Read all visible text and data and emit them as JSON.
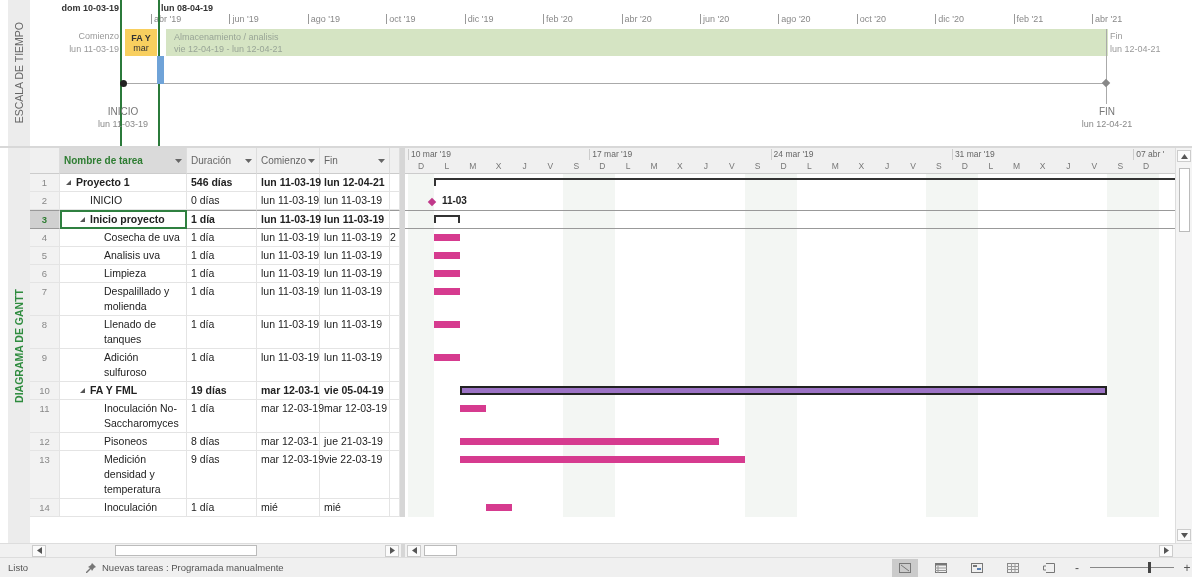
{
  "timeline": {
    "label": "ESCALA DE TIEMPO",
    "range_start": "dom 10-03-19",
    "range_end": "lun 08-04-19",
    "ticks": [
      "abr '19",
      "jun '19",
      "ago '19",
      "oct '19",
      "dic '19",
      "feb '20",
      "abr '20",
      "jun '20",
      "ago '20",
      "oct '20",
      "dic '20",
      "feb '21",
      "abr '21"
    ],
    "start": {
      "label": "Comienzo",
      "date": "lun 11-03-19"
    },
    "finish": {
      "label": "Fin",
      "date": "lun 12-04-21"
    },
    "bars": [
      {
        "kind": "callout",
        "name": "FA Y",
        "date": "mar",
        "color": "#f8cf5f"
      },
      {
        "kind": "span",
        "name": "Almacenamiento / analisis",
        "date": "vie 12-04-19 - lun 12-04-21",
        "color": "#d5e4c3"
      },
      {
        "kind": "marker",
        "color": "#6fa3d8"
      }
    ],
    "milestones": [
      {
        "kind": "start",
        "name": "INICIO",
        "date": "lun 11-03-19"
      },
      {
        "kind": "finish",
        "name": "FIN",
        "date": "lun 12-04-21"
      }
    ]
  },
  "view_label": "DIAGRAMA DE GANTT",
  "table": {
    "columns": [
      {
        "label": "Nombre de tarea",
        "selected": true
      },
      {
        "label": "Duración",
        "selected": false
      },
      {
        "label": "Comienzo",
        "selected": false
      },
      {
        "label": "Fin",
        "selected": false
      }
    ],
    "rows": [
      {
        "id": "1",
        "name": "Proyecto 1",
        "duration": "546 días",
        "start": "lun 11-03-19",
        "finish": "lun 12-04-21",
        "kind": "summary",
        "expanded": true,
        "selected": false,
        "children": [
          {
            "id": "2",
            "name": "INICIO",
            "duration": "0 días",
            "start": "lun 11-03-19",
            "finish": "lun 11-03-19",
            "kind": "milestone",
            "bar_label": "11-03",
            "selected": false
          },
          {
            "id": "3",
            "name": "Inicio proyecto",
            "duration": "1 día",
            "start": "lun 11-03-19",
            "finish": "lun 11-03-19",
            "kind": "summary",
            "expanded": true,
            "selected": true,
            "children": [
              {
                "id": "4",
                "name": "Cosecha de uva",
                "duration": "1 día",
                "start": "lun 11-03-19",
                "finish": "lun 11-03-19",
                "column_5": "2",
                "kind": "task",
                "selected": false
              },
              {
                "id": "5",
                "name": "Analisis uva",
                "duration": "1 día",
                "start": "lun 11-03-19",
                "finish": "lun 11-03-19",
                "kind": "task",
                "selected": false
              },
              {
                "id": "6",
                "name": "Limpieza",
                "duration": "1 día",
                "start": "lun 11-03-19",
                "finish": "lun 11-03-19",
                "kind": "task",
                "selected": false
              },
              {
                "id": "7",
                "name": "Despalillado y molienda",
                "duration": "1 día",
                "start": "lun 11-03-19",
                "finish": "lun 11-03-19",
                "kind": "task",
                "selected": false
              },
              {
                "id": "8",
                "name": "Llenado de tanques",
                "duration": "1 día",
                "start": "lun 11-03-19",
                "finish": "lun 11-03-19",
                "kind": "task",
                "selected": false
              },
              {
                "id": "9",
                "name": "Adición sulfuroso",
                "duration": "1 día",
                "start": "lun 11-03-19",
                "finish": "lun 11-03-19",
                "kind": "task",
                "selected": false
              }
            ]
          },
          {
            "id": "10",
            "name": "FA Y FML",
            "duration": "19 días",
            "start": "mar 12-03-1",
            "finish": "vie 05-04-19",
            "kind": "summary_filled",
            "expanded": true,
            "selected": false,
            "children": [
              {
                "id": "11",
                "name": "Inoculación No-Saccharomyces",
                "duration": "1 día",
                "start": "mar 12-03-19",
                "finish": "mar 12-03-19",
                "kind": "task",
                "selected": false
              },
              {
                "id": "12",
                "name": "Pisoneos",
                "duration": "8 días",
                "start": "mar 12-03-1",
                "finish": "jue 21-03-19",
                "kind": "task",
                "selected": false
              },
              {
                "id": "13",
                "name": "Medición densidad y temperatura",
                "duration": "9 días",
                "start": "mar 12-03-19",
                "finish": "vie 22-03-19",
                "kind": "task",
                "selected": false
              },
              {
                "id": "14",
                "name": "Inoculación",
                "duration": "1 día",
                "start": "mié",
                "finish": "mié",
                "kind": "task",
                "selected": false
              }
            ]
          }
        ]
      }
    ]
  },
  "gantt": {
    "weeks": [
      "10 mar '19",
      "17 mar '19",
      "24 mar '19",
      "31 mar '19",
      "07 abr '"
    ],
    "days": [
      "D",
      "L",
      "M",
      "X",
      "J",
      "V",
      "S",
      "D",
      "L",
      "M",
      "X",
      "J",
      "V",
      "S",
      "D",
      "L",
      "M",
      "X",
      "J",
      "V",
      "S",
      "D",
      "L",
      "M",
      "X",
      "J",
      "V",
      "S",
      "D"
    ]
  },
  "status_bar": {
    "text": "Listo",
    "new_tasks": "Nuevas tareas : Programada manualmente",
    "views": [
      {
        "kind": "gantt",
        "selected": true
      },
      {
        "kind": "sheet",
        "selected": false
      },
      {
        "kind": "team",
        "selected": false
      },
      {
        "kind": "grid",
        "selected": false
      },
      {
        "kind": "report",
        "selected": false
      }
    ],
    "zoom": {
      "minus": "-",
      "plus": "+",
      "level": 0.7
    }
  }
}
